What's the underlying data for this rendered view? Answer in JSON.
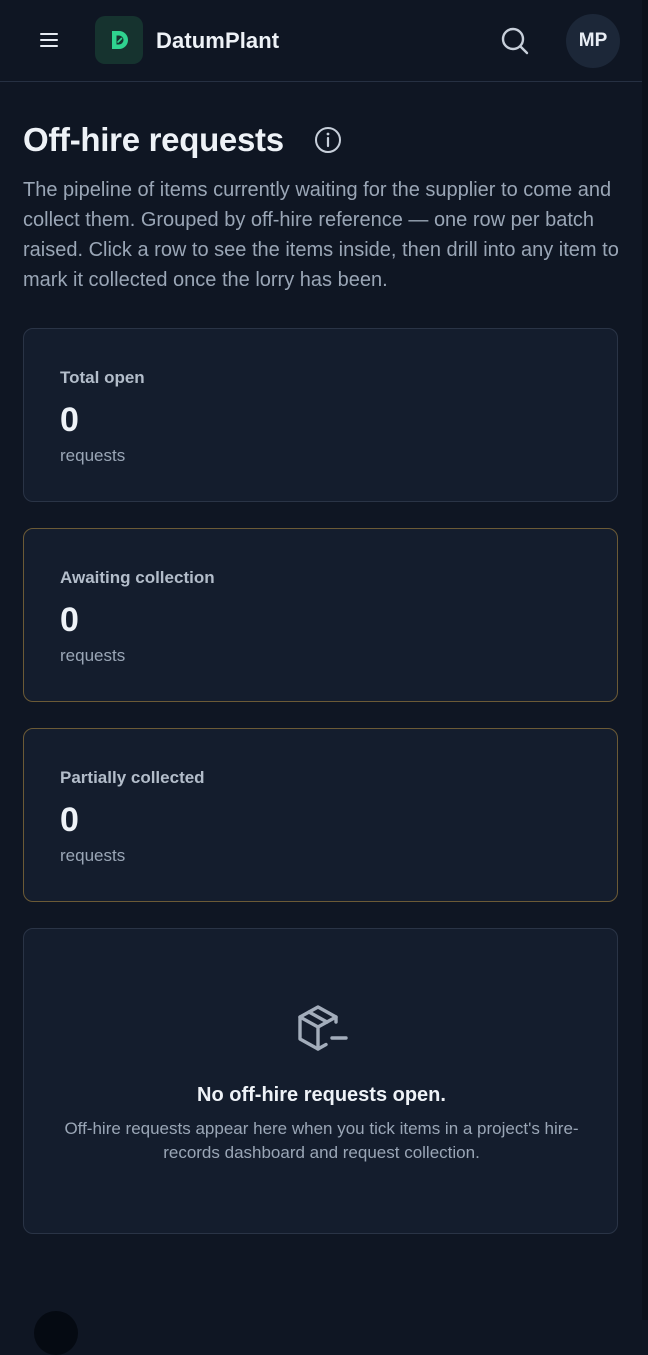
{
  "header": {
    "brand": "DatumPlant",
    "logo_letter": "D",
    "avatar_initials": "MP",
    "icons": {
      "menu": "hamburger-menu-icon",
      "logo": "datumplant-logo-icon",
      "search": "search-icon"
    }
  },
  "page": {
    "title": "Off-hire requests",
    "title_icon": "info-icon",
    "description": "The pipeline of items currently waiting for the supplier to come and collect them. Grouped by off-hire reference — one row per batch raised. Click a row to see the items inside, then drill into any item to mark it collected once the lorry has been."
  },
  "stats": [
    {
      "label": "Total open",
      "value": "0",
      "unit": "requests"
    },
    {
      "label": "Awaiting collection",
      "value": "0",
      "unit": "requests"
    },
    {
      "label": "Partially collected",
      "value": "0",
      "unit": "requests"
    }
  ],
  "empty_state": {
    "icon": "package-minus-icon",
    "title": "No off-hire requests open.",
    "text": "Off-hire requests appear here when you tick items in a project's hire-records dashboard and request collection."
  },
  "colors": {
    "background": "#0f1623",
    "card": "#141d2d",
    "accent_green": "#2fd38f",
    "amber_border": "#6b5a36"
  }
}
